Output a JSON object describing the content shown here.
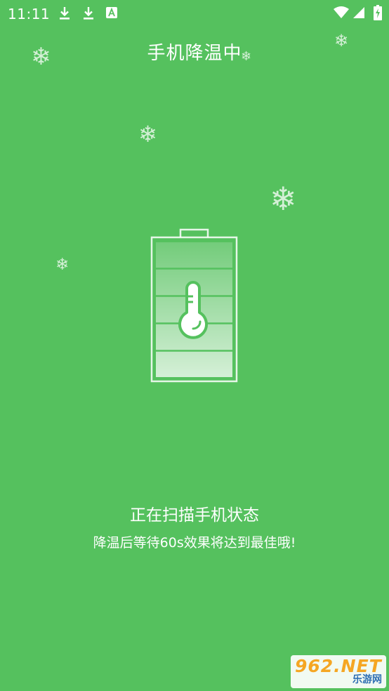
{
  "status_bar": {
    "time": "11:11",
    "icons": [
      "download-icon",
      "download-icon",
      "a-notification-icon",
      "wifi-icon",
      "signal-icon",
      "battery-charging-icon"
    ]
  },
  "title": "手机降温中",
  "battery_graphic": {
    "icon": "thermometer-icon",
    "levels": 5
  },
  "message": {
    "line1": "正在扫描手机状态",
    "line2": "降温后等待60s效果将达到最佳哦!"
  },
  "watermark": {
    "brand": "962.NET",
    "subtitle": "乐游网"
  },
  "colors": {
    "background": "#55c15e",
    "foreground": "#ffffff"
  }
}
